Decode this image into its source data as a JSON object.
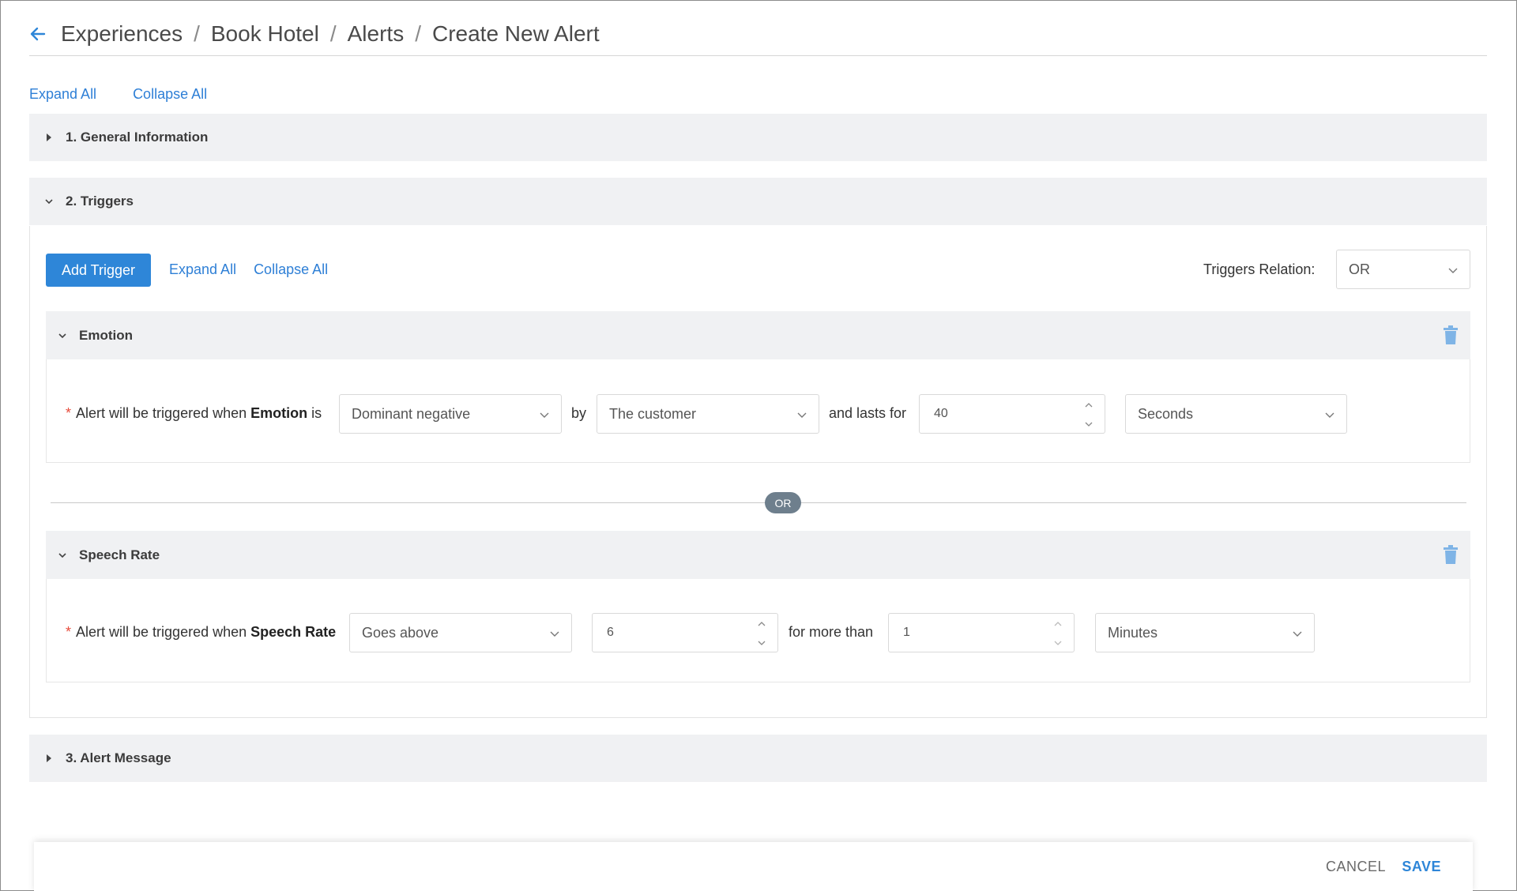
{
  "breadcrumb": [
    "Experiences",
    "Book Hotel",
    "Alerts",
    "Create New Alert"
  ],
  "breadcrumb_separator": "/",
  "top_links": {
    "expand_all": "Expand All",
    "collapse_all": "Collapse All"
  },
  "sections": {
    "general": {
      "title": "1. General Information",
      "expanded": false
    },
    "triggers": {
      "title": "2. Triggers",
      "expanded": true
    },
    "alert_message": {
      "title": "3. Alert Message",
      "expanded": false
    }
  },
  "triggers_panel": {
    "add_trigger_label": "Add Trigger",
    "expand_all": "Expand All",
    "collapse_all": "Collapse All",
    "relation_label": "Triggers Relation:",
    "relation_value": "OR",
    "or_badge": "OR"
  },
  "emotion_trigger": {
    "title": "Emotion",
    "prefix": "Alert will be triggered when",
    "metric": "Emotion",
    "is": "is",
    "condition": "Dominant negative",
    "by": "by",
    "subject": "The customer",
    "lasts_for": "and lasts for",
    "duration": "40",
    "unit": "Seconds"
  },
  "speech_trigger": {
    "title": "Speech Rate",
    "prefix": "Alert will be triggered when",
    "metric": "Speech Rate",
    "condition": "Goes above",
    "threshold": "6",
    "for_more_than": "for more than",
    "duration": "1",
    "unit": "Minutes"
  },
  "footer": {
    "cancel": "CANCEL",
    "save": "SAVE"
  },
  "colors": {
    "accent": "#2e86d8",
    "section_bg": "#f0f1f3",
    "required": "#e74c3c",
    "or_badge": "#6e7f8d"
  }
}
